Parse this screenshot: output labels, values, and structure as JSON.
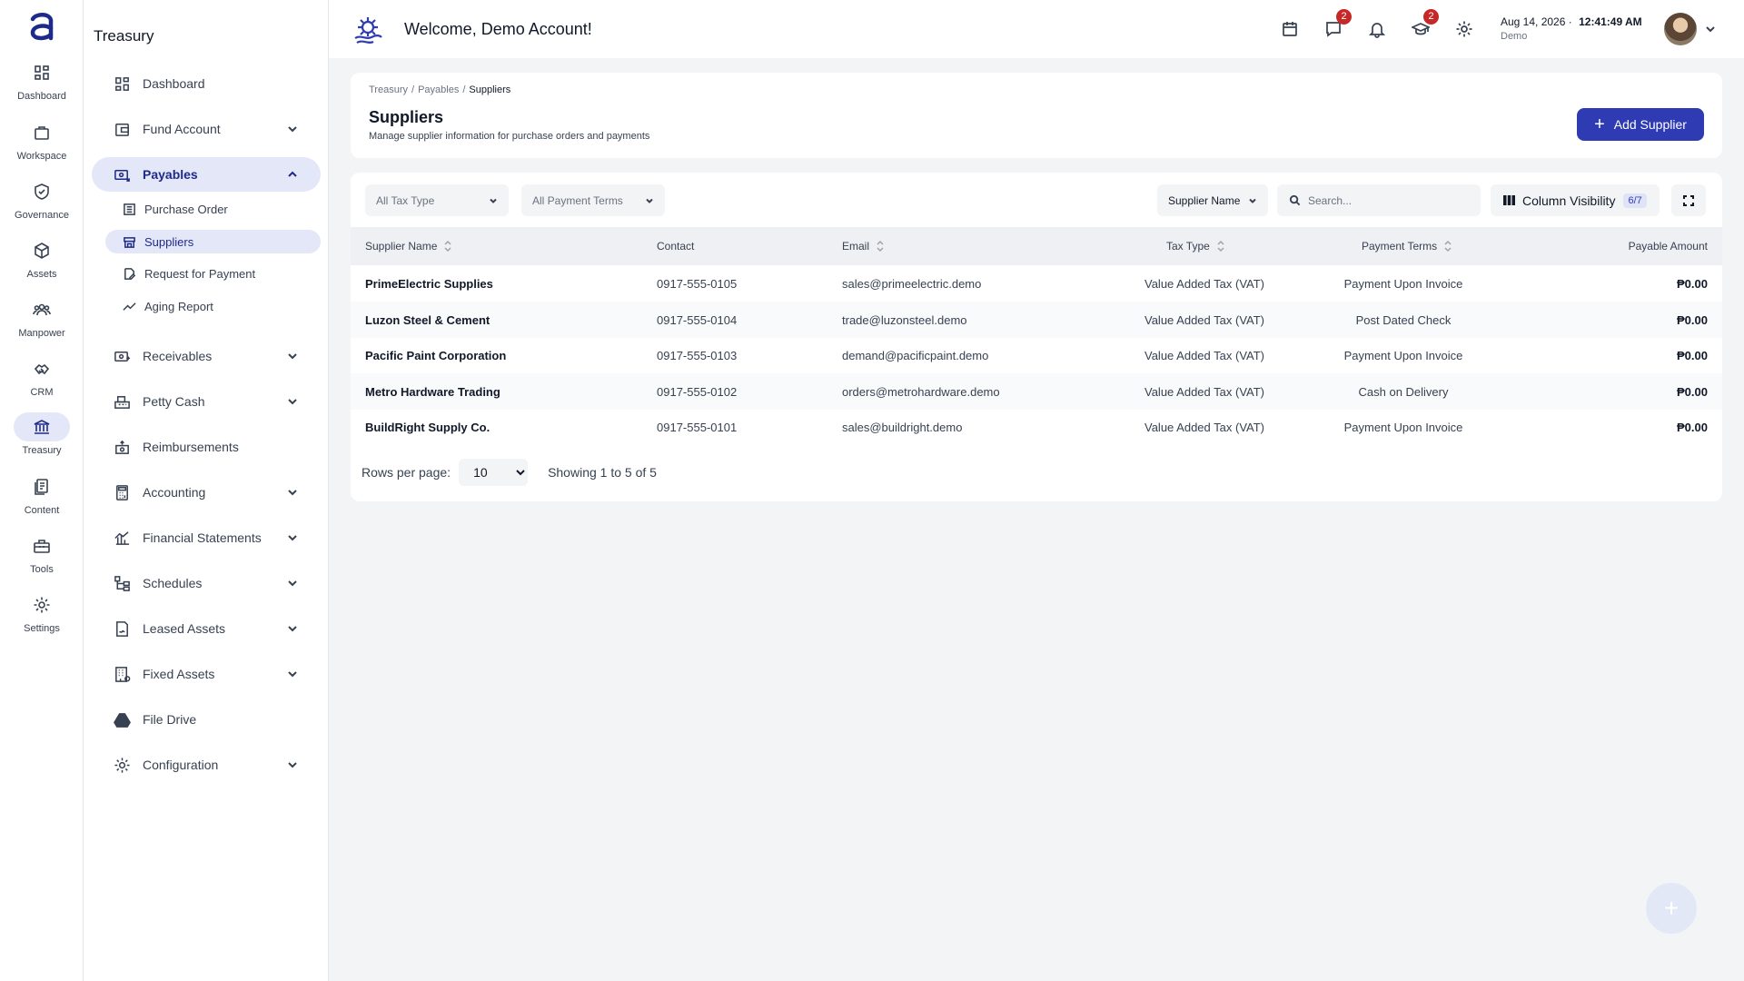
{
  "rail": {
    "items": [
      {
        "label": "Dashboard"
      },
      {
        "label": "Workspace"
      },
      {
        "label": "Governance"
      },
      {
        "label": "Assets"
      },
      {
        "label": "Manpower"
      },
      {
        "label": "CRM"
      },
      {
        "label": "Treasury"
      },
      {
        "label": "Content"
      },
      {
        "label": "Tools"
      },
      {
        "label": "Settings"
      }
    ],
    "active": "Treasury"
  },
  "sidebar": {
    "title": "Treasury",
    "items": [
      {
        "label": "Dashboard"
      },
      {
        "label": "Fund Account"
      },
      {
        "label": "Payables"
      },
      {
        "label": "Receivables"
      },
      {
        "label": "Petty Cash"
      },
      {
        "label": "Reimbursements"
      },
      {
        "label": "Accounting"
      },
      {
        "label": "Financial Statements"
      },
      {
        "label": "Schedules"
      },
      {
        "label": "Leased Assets"
      },
      {
        "label": "Fixed Assets"
      },
      {
        "label": "File Drive"
      },
      {
        "label": "Configuration"
      }
    ],
    "payables_sub": [
      {
        "label": "Purchase Order"
      },
      {
        "label": "Suppliers"
      },
      {
        "label": "Request for Payment"
      },
      {
        "label": "Aging Report"
      }
    ]
  },
  "topbar": {
    "welcome": "Welcome, Demo Account!",
    "messages_badge": "2",
    "learning_badge": "2",
    "date": "Aug 14, 2026",
    "separator": "·",
    "time": "12:41:49 AM",
    "user": "Demo"
  },
  "header": {
    "breadcrumb": [
      "Treasury",
      "Payables",
      "Suppliers"
    ],
    "title": "Suppliers",
    "subtitle": "Manage supplier information for purchase orders and payments",
    "add_label": "Add Supplier"
  },
  "filters": {
    "tax_type": "All Tax Type",
    "payment_terms": "All Payment Terms",
    "search_field": "Supplier Name",
    "search_placeholder": "Search...",
    "column_visibility": "Column Visibility",
    "column_count": "6/7"
  },
  "table": {
    "columns": [
      "Supplier Name",
      "Contact",
      "Email",
      "Tax Type",
      "Payment Terms",
      "Payable Amount"
    ],
    "rows": [
      {
        "name": "PrimeElectric Supplies",
        "contact": "0917-555-0105",
        "email": "sales@primeelectric.demo",
        "tax": "Value Added Tax (VAT)",
        "terms": "Payment Upon Invoice",
        "amount": "₱0.00"
      },
      {
        "name": "Luzon Steel & Cement",
        "contact": "0917-555-0104",
        "email": "trade@luzonsteel.demo",
        "tax": "Value Added Tax (VAT)",
        "terms": "Post Dated Check",
        "amount": "₱0.00"
      },
      {
        "name": "Pacific Paint Corporation",
        "contact": "0917-555-0103",
        "email": "demand@pacificpaint.demo",
        "tax": "Value Added Tax (VAT)",
        "terms": "Payment Upon Invoice",
        "amount": "₱0.00"
      },
      {
        "name": "Metro Hardware Trading",
        "contact": "0917-555-0102",
        "email": "orders@metrohardware.demo",
        "tax": "Value Added Tax (VAT)",
        "terms": "Cash on Delivery",
        "amount": "₱0.00"
      },
      {
        "name": "BuildRight Supply Co.",
        "contact": "0917-555-0101",
        "email": "sales@buildright.demo",
        "tax": "Value Added Tax (VAT)",
        "terms": "Payment Upon Invoice",
        "amount": "₱0.00"
      }
    ]
  },
  "pagination": {
    "rows_label": "Rows per page:",
    "rows_value": "10",
    "showing": "Showing 1 to 5 of 5"
  },
  "fab": {
    "label": "+"
  },
  "colors": {
    "accent": "#2f3bb3",
    "active_bg": "#e3e7f7",
    "badge": "#c62828"
  }
}
